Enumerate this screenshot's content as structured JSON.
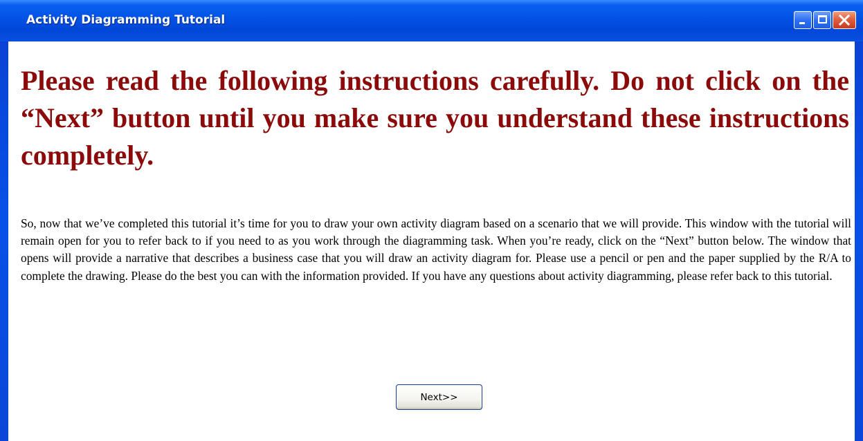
{
  "window": {
    "title": "Activity Diagramming Tutorial",
    "controls": {
      "minimize_icon": "minimize-icon",
      "maximize_icon": "maximize-icon",
      "close_icon": "close-icon"
    }
  },
  "content": {
    "heading": "Please read the following instructions carefully.  Do not click on the “Next” button until you make sure you understand these instructions completely.",
    "body": "So, now that we’ve completed this tutorial it’s time for you to draw your own activity diagram based on a scenario that we will provide.  This window with the tutorial will remain open for you to refer back to if you need to as you work through the diagramming task.  When you’re ready, click on the “Next” button below.  The window that opens will provide a narrative that describes a business case that you will draw an activity diagram for.  Please use a pencil or pen and the paper supplied by the R/A to complete the drawing.  Please do the best you can with the information provided.  If you have any questions about activity diagramming, please refer back to this tutorial.",
    "next_label": "Next>>"
  },
  "colors": {
    "heading": "#8b0a0a",
    "titlebar": "#0454e6",
    "close_button": "#e06040"
  }
}
